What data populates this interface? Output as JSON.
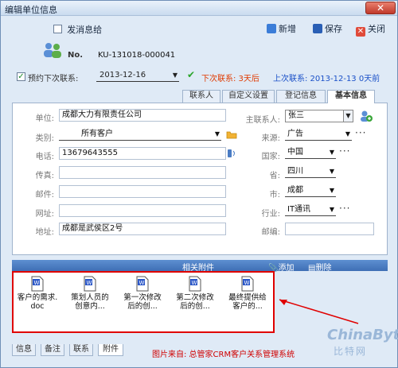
{
  "window": {
    "title": "编辑单位信息",
    "close": "✕"
  },
  "toolbar": {
    "send_msg_label": "发消息给",
    "new_label": "新增",
    "save_label": "保存",
    "close_label": "关闭"
  },
  "header": {
    "no_label": "No.",
    "no_value": "KU-131018-000041",
    "reserve_label": "预约下次联系:",
    "reserve_date": "2013-12-16",
    "next_contact": "下次联系: 3天后",
    "last_contact": "上次联系: 2013-12-13 0天前"
  },
  "tabs": [
    "联系人",
    "自定义设置",
    "登记信息",
    "基本信息"
  ],
  "form": {
    "unit_label": "单位:",
    "unit_value": "成都大力有限责任公司",
    "type_label": "类别:",
    "type_value": "所有客户",
    "phone_label": "电话:",
    "phone_value": "13679643555",
    "fax_label": "传真:",
    "fax_value": "",
    "mail_label": "邮件:",
    "mail_value": "",
    "web_label": "网址:",
    "web_value": "",
    "addr_label": "地址:",
    "addr_value": "成都是武侯区2号",
    "main_contact_label": "主联系人:",
    "main_contact_value": "张三",
    "source_label": "来源:",
    "source_value": "广告",
    "country_label": "国家:",
    "country_value": "中国",
    "province_label": "省:",
    "province_value": "四川",
    "city_label": "市:",
    "city_value": "成都",
    "industry_label": "行业:",
    "industry_value": "IT通讯",
    "zip_label": "邮编:",
    "zip_value": ""
  },
  "attachments": {
    "title": "相关附件",
    "add_label": "添加",
    "delete_label": "删除",
    "files": [
      {
        "line1": "客户的需求.",
        "line2": "doc"
      },
      {
        "line1": "策划人员的",
        "line2": "创意内..."
      },
      {
        "line1": "第一次修改",
        "line2": "后的创..."
      },
      {
        "line1": "第二次修改",
        "line2": "后的创..."
      },
      {
        "line1": "最终提供给",
        "line2": "客户的..."
      }
    ]
  },
  "bottom_tabs": [
    "信息",
    "备注",
    "联系",
    "附件"
  ],
  "source_note": "图片来自: 总管家CRM客户关系管理系统",
  "watermark": {
    "line1": "ChinaByte",
    "line2": "比特网"
  },
  "colors": {
    "accent": "#3f6fb5",
    "next": "#e03a00",
    "last": "#1a50c8",
    "highlight": "#e00000"
  }
}
